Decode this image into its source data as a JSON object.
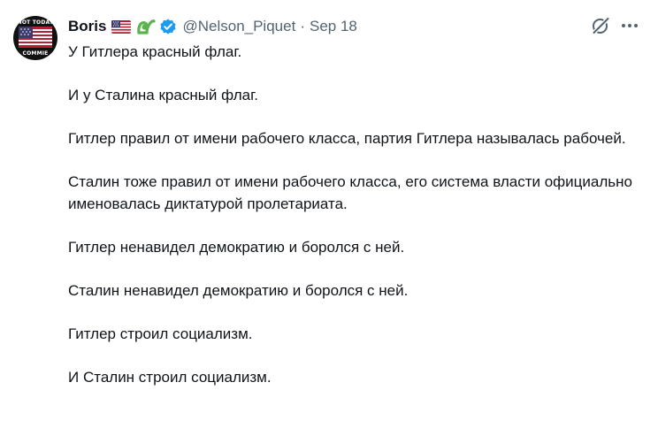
{
  "author": {
    "name": "Boris",
    "handle": "@Nelson_Piquet",
    "avatar_caption_top": "NOT TODAY",
    "avatar_caption_bottom": "COMMIE"
  },
  "meta": {
    "separator": "·",
    "date": "Sep 18"
  },
  "icons": {
    "flag": "us-flag-icon",
    "badge": "green-badge-icon",
    "verified": "verified-check-icon",
    "grok": "grok-icon",
    "more": "more-options-icon"
  },
  "colors": {
    "text": "#0f1419",
    "secondary": "#536471",
    "verified": "#1d9bf0",
    "badge_green": "#5bb34d"
  },
  "paragraphs": [
    "У Гитлера красный флаг.",
    "И у Сталина красный флаг.",
    "Гитлер правил от имени рабочего класса, партия Гитлера называлась рабочей.",
    "Сталин тоже правил от имени рабочего класса, его система власти официально именовалась диктатурой пролетариата.",
    "Гитлер ненавидел демократию и боролся с ней.",
    "Сталин ненавидел демократию и боролся с ней.",
    "Гитлер строил социализм.",
    "И Сталин строил социализм."
  ]
}
